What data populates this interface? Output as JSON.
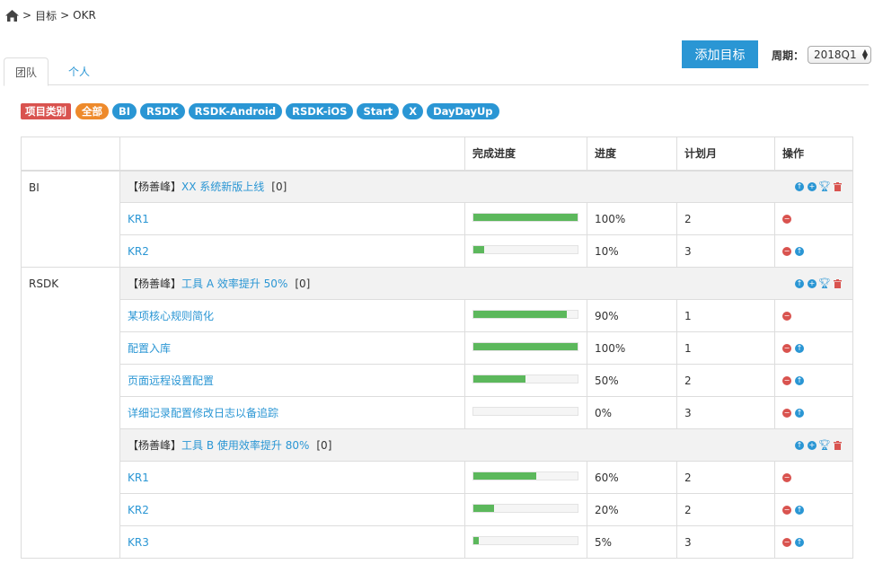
{
  "breadcrumb": {
    "home_icon": "home-icon",
    "items": [
      "目标",
      "OKR"
    ],
    "sep": ">"
  },
  "toolbar": {
    "add_label": "添加目标",
    "period_label": "周期：",
    "period_value": "2018Q1"
  },
  "tabs": [
    {
      "label": "团队",
      "active": true
    },
    {
      "label": "个人",
      "active": false
    }
  ],
  "filters": {
    "title": "项目类别",
    "items": [
      "全部",
      "BI",
      "RSDK",
      "RSDK-Android",
      "RSDK-iOS",
      "Start",
      "X",
      "DayDayUp"
    ]
  },
  "table": {
    "headers": {
      "blank1": "",
      "blank2": "",
      "progress_bar": "完成进度",
      "progress": "进度",
      "plan_month": "计划月",
      "ops": "操作"
    },
    "groups": [
      {
        "category": "BI",
        "objectives": [
          {
            "owner": "【杨善峰】",
            "title": "XX 系统新版上线",
            "count": "[0]",
            "krs": [
              {
                "name": "KR1",
                "progress": 100,
                "progress_text": "100%",
                "month": "2",
                "ops": [
                  "minus-circle-icon"
                ]
              },
              {
                "name": "KR2",
                "progress": 10,
                "progress_text": "10%",
                "month": "3",
                "ops": [
                  "minus-circle-icon",
                  "arrow-up-circle-icon"
                ]
              }
            ]
          }
        ]
      },
      {
        "category": "RSDK",
        "objectives": [
          {
            "owner": "【杨善峰】",
            "title": "工具 A 效率提升 50%",
            "count": "[0]",
            "krs": [
              {
                "name": "某项核心规则简化",
                "progress": 90,
                "progress_text": "90%",
                "month": "1",
                "ops": [
                  "minus-circle-icon"
                ]
              },
              {
                "name": "配置入库",
                "progress": 100,
                "progress_text": "100%",
                "month": "1",
                "ops": [
                  "minus-circle-icon",
                  "arrow-up-circle-icon"
                ]
              },
              {
                "name": "页面远程设置配置",
                "progress": 50,
                "progress_text": "50%",
                "month": "2",
                "ops": [
                  "minus-circle-icon",
                  "arrow-up-circle-icon"
                ]
              },
              {
                "name": "详细记录配置修改日志以备追踪",
                "progress": 0,
                "progress_text": "0%",
                "month": "3",
                "ops": [
                  "minus-circle-icon",
                  "arrow-up-circle-icon"
                ]
              }
            ]
          },
          {
            "owner": "【杨善峰】",
            "title": "工具 B 使用效率提升 80%",
            "count": "[0]",
            "krs": [
              {
                "name": "KR1",
                "progress": 60,
                "progress_text": "60%",
                "month": "2",
                "ops": [
                  "minus-circle-icon"
                ]
              },
              {
                "name": "KR2",
                "progress": 20,
                "progress_text": "20%",
                "month": "2",
                "ops": [
                  "minus-circle-icon",
                  "arrow-up-circle-icon"
                ]
              },
              {
                "name": "KR3",
                "progress": 5,
                "progress_text": "5%",
                "month": "3",
                "ops": [
                  "minus-circle-icon",
                  "arrow-up-circle-icon"
                ]
              }
            ]
          }
        ]
      }
    ]
  },
  "colors": {
    "accent": "#2a96d4",
    "all_pill": "#ee8a2b",
    "category_label": "#d9534f",
    "progress_fill": "#5cb85c",
    "objective_bg": "#f2f2f2"
  }
}
